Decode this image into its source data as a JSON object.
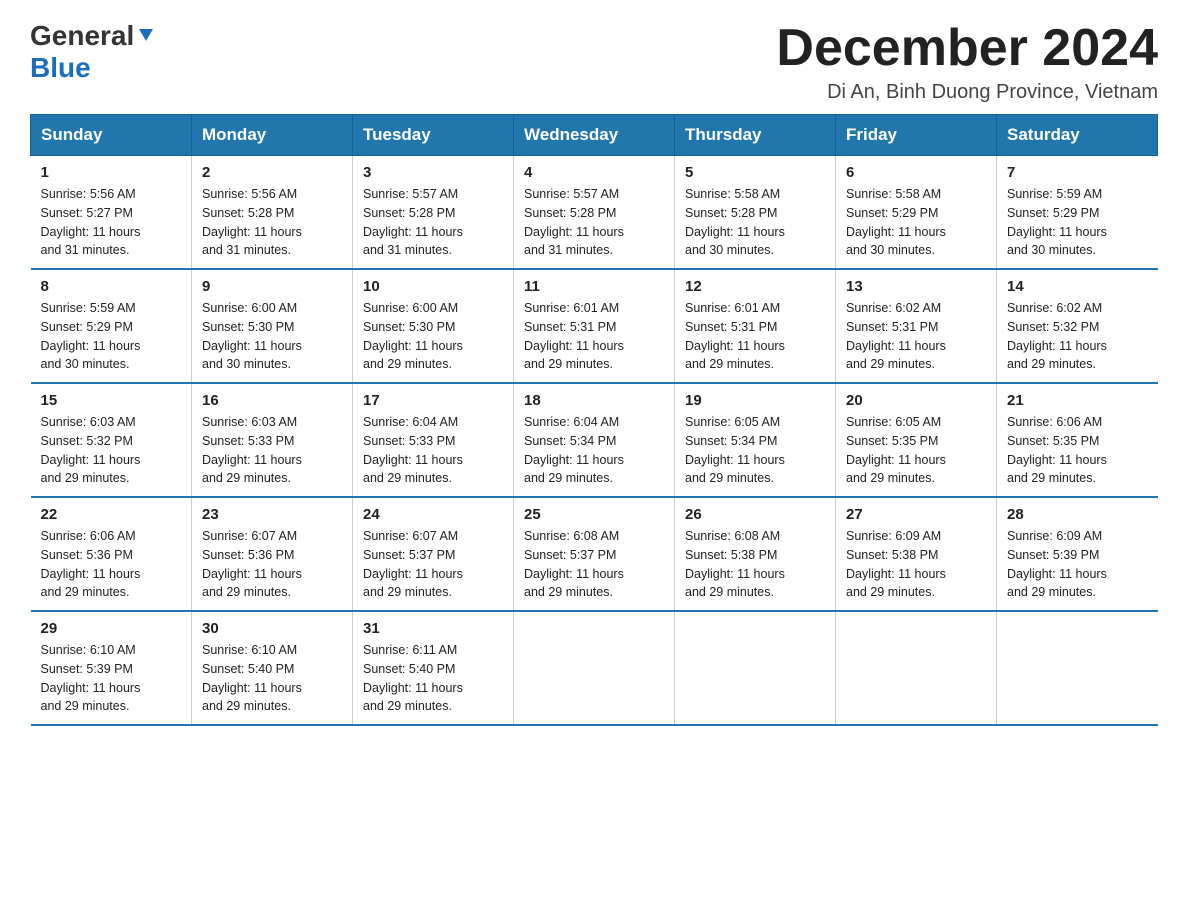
{
  "header": {
    "logo_general": "General",
    "logo_blue": "Blue",
    "month_title": "December 2024",
    "location": "Di An, Binh Duong Province, Vietnam"
  },
  "days_of_week": [
    "Sunday",
    "Monday",
    "Tuesday",
    "Wednesday",
    "Thursday",
    "Friday",
    "Saturday"
  ],
  "weeks": [
    [
      {
        "day": "1",
        "sunrise": "5:56 AM",
        "sunset": "5:27 PM",
        "daylight": "11 hours and 31 minutes."
      },
      {
        "day": "2",
        "sunrise": "5:56 AM",
        "sunset": "5:28 PM",
        "daylight": "11 hours and 31 minutes."
      },
      {
        "day": "3",
        "sunrise": "5:57 AM",
        "sunset": "5:28 PM",
        "daylight": "11 hours and 31 minutes."
      },
      {
        "day": "4",
        "sunrise": "5:57 AM",
        "sunset": "5:28 PM",
        "daylight": "11 hours and 31 minutes."
      },
      {
        "day": "5",
        "sunrise": "5:58 AM",
        "sunset": "5:28 PM",
        "daylight": "11 hours and 30 minutes."
      },
      {
        "day": "6",
        "sunrise": "5:58 AM",
        "sunset": "5:29 PM",
        "daylight": "11 hours and 30 minutes."
      },
      {
        "day": "7",
        "sunrise": "5:59 AM",
        "sunset": "5:29 PM",
        "daylight": "11 hours and 30 minutes."
      }
    ],
    [
      {
        "day": "8",
        "sunrise": "5:59 AM",
        "sunset": "5:29 PM",
        "daylight": "11 hours and 30 minutes."
      },
      {
        "day": "9",
        "sunrise": "6:00 AM",
        "sunset": "5:30 PM",
        "daylight": "11 hours and 30 minutes."
      },
      {
        "day": "10",
        "sunrise": "6:00 AM",
        "sunset": "5:30 PM",
        "daylight": "11 hours and 29 minutes."
      },
      {
        "day": "11",
        "sunrise": "6:01 AM",
        "sunset": "5:31 PM",
        "daylight": "11 hours and 29 minutes."
      },
      {
        "day": "12",
        "sunrise": "6:01 AM",
        "sunset": "5:31 PM",
        "daylight": "11 hours and 29 minutes."
      },
      {
        "day": "13",
        "sunrise": "6:02 AM",
        "sunset": "5:31 PM",
        "daylight": "11 hours and 29 minutes."
      },
      {
        "day": "14",
        "sunrise": "6:02 AM",
        "sunset": "5:32 PM",
        "daylight": "11 hours and 29 minutes."
      }
    ],
    [
      {
        "day": "15",
        "sunrise": "6:03 AM",
        "sunset": "5:32 PM",
        "daylight": "11 hours and 29 minutes."
      },
      {
        "day": "16",
        "sunrise": "6:03 AM",
        "sunset": "5:33 PM",
        "daylight": "11 hours and 29 minutes."
      },
      {
        "day": "17",
        "sunrise": "6:04 AM",
        "sunset": "5:33 PM",
        "daylight": "11 hours and 29 minutes."
      },
      {
        "day": "18",
        "sunrise": "6:04 AM",
        "sunset": "5:34 PM",
        "daylight": "11 hours and 29 minutes."
      },
      {
        "day": "19",
        "sunrise": "6:05 AM",
        "sunset": "5:34 PM",
        "daylight": "11 hours and 29 minutes."
      },
      {
        "day": "20",
        "sunrise": "6:05 AM",
        "sunset": "5:35 PM",
        "daylight": "11 hours and 29 minutes."
      },
      {
        "day": "21",
        "sunrise": "6:06 AM",
        "sunset": "5:35 PM",
        "daylight": "11 hours and 29 minutes."
      }
    ],
    [
      {
        "day": "22",
        "sunrise": "6:06 AM",
        "sunset": "5:36 PM",
        "daylight": "11 hours and 29 minutes."
      },
      {
        "day": "23",
        "sunrise": "6:07 AM",
        "sunset": "5:36 PM",
        "daylight": "11 hours and 29 minutes."
      },
      {
        "day": "24",
        "sunrise": "6:07 AM",
        "sunset": "5:37 PM",
        "daylight": "11 hours and 29 minutes."
      },
      {
        "day": "25",
        "sunrise": "6:08 AM",
        "sunset": "5:37 PM",
        "daylight": "11 hours and 29 minutes."
      },
      {
        "day": "26",
        "sunrise": "6:08 AM",
        "sunset": "5:38 PM",
        "daylight": "11 hours and 29 minutes."
      },
      {
        "day": "27",
        "sunrise": "6:09 AM",
        "sunset": "5:38 PM",
        "daylight": "11 hours and 29 minutes."
      },
      {
        "day": "28",
        "sunrise": "6:09 AM",
        "sunset": "5:39 PM",
        "daylight": "11 hours and 29 minutes."
      }
    ],
    [
      {
        "day": "29",
        "sunrise": "6:10 AM",
        "sunset": "5:39 PM",
        "daylight": "11 hours and 29 minutes."
      },
      {
        "day": "30",
        "sunrise": "6:10 AM",
        "sunset": "5:40 PM",
        "daylight": "11 hours and 29 minutes."
      },
      {
        "day": "31",
        "sunrise": "6:11 AM",
        "sunset": "5:40 PM",
        "daylight": "11 hours and 29 minutes."
      },
      null,
      null,
      null,
      null
    ]
  ],
  "labels": {
    "sunrise": "Sunrise:",
    "sunset": "Sunset:",
    "daylight": "Daylight:"
  },
  "colors": {
    "header_bg": "#2176ae",
    "header_text": "#ffffff",
    "border": "#2176ae"
  }
}
